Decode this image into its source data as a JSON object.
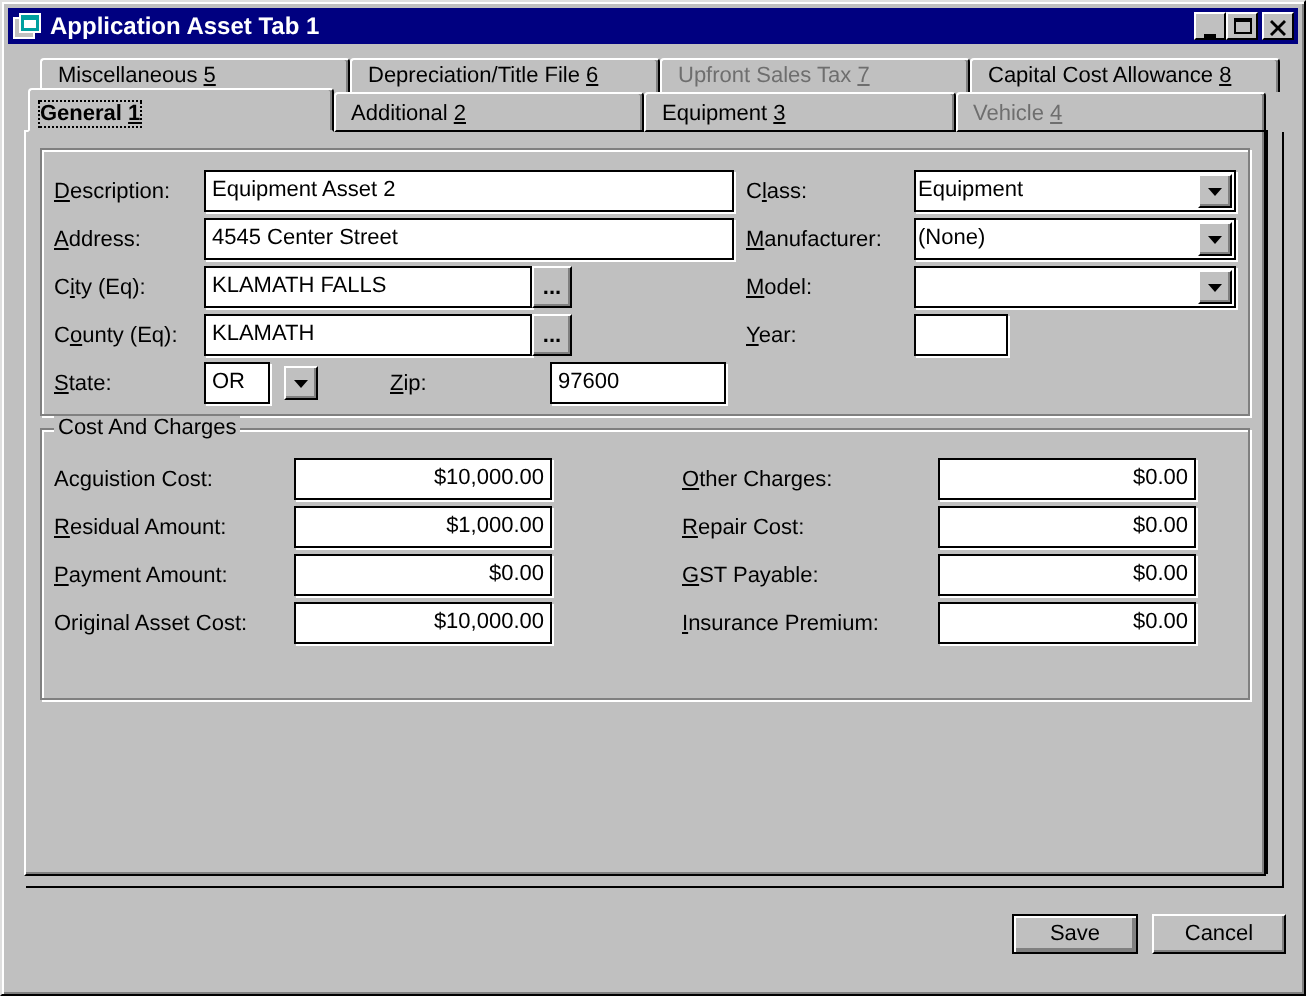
{
  "window": {
    "title": "Application Asset Tab 1"
  },
  "tab_rows": [
    [
      {
        "label": {
          "pre": "Miscellaneous ",
          "key": "5"
        },
        "selected": false,
        "disabled": false
      },
      {
        "label": {
          "pre": "Depreciation/Title File ",
          "key": "6"
        },
        "selected": false,
        "disabled": false
      },
      {
        "label": {
          "pre": "Upfront Sales Tax ",
          "key": "7"
        },
        "selected": false,
        "disabled": true
      },
      {
        "label": {
          "pre": "Capital Cost Allowance ",
          "key": "8"
        },
        "selected": false,
        "disabled": false
      }
    ],
    [
      {
        "label": {
          "pre": "General ",
          "key": "1"
        },
        "selected": true,
        "disabled": false
      },
      {
        "label": {
          "pre": "Additional ",
          "key": "2"
        },
        "selected": false,
        "disabled": false
      },
      {
        "label": {
          "pre": "Equipment ",
          "key": "3"
        },
        "selected": false,
        "disabled": false
      },
      {
        "label": {
          "pre": "Vehicle ",
          "key": "4"
        },
        "selected": false,
        "disabled": true
      }
    ]
  ],
  "general": {
    "left": [
      {
        "kind": "text",
        "label": {
          "key": "D",
          "post": "escription:"
        },
        "value": "Equipment Asset 2"
      },
      {
        "kind": "text",
        "label": {
          "key": "A",
          "post": "ddress:"
        },
        "value": "4545 Center Street"
      },
      {
        "kind": "lookup",
        "label": {
          "pre": "C",
          "key": "i",
          "post": "ty (Eq):"
        },
        "value": "KLAMATH FALLS",
        "button": "..."
      },
      {
        "kind": "lookup",
        "label": {
          "pre": "C",
          "key": "o",
          "post": "unty (Eq):"
        },
        "value": "KLAMATH",
        "button": "..."
      },
      {
        "kind": "state_zip",
        "label": {
          "key": "S",
          "post": "tate:"
        },
        "value": "OR",
        "zip_label": {
          "key": "Z",
          "post": "ip:"
        },
        "zip_value": "97600"
      }
    ],
    "right": [
      {
        "kind": "dropdown",
        "label": {
          "pre": "C",
          "key": "l",
          "post": "ass:"
        },
        "value": "Equipment"
      },
      {
        "kind": "dropdown",
        "label": {
          "key": "M",
          "post": "anufacturer:"
        },
        "value": "(None)"
      },
      {
        "kind": "dropdown",
        "label": {
          "key": "M",
          "post": "odel:"
        }
      },
      {
        "kind": "short",
        "label": {
          "key": "Y",
          "post": "ear:"
        }
      }
    ]
  },
  "costs": {
    "title": "Cost And Charges",
    "left": [
      {
        "label": {
          "pre": "Acguistion Cost:"
        },
        "value": "$10,000.00"
      },
      {
        "label": {
          "key": "R",
          "post": "esidual Amount:"
        },
        "value": "$1,000.00"
      },
      {
        "label": {
          "key": "P",
          "post": "ayment Amount:"
        },
        "value": "$0.00"
      },
      {
        "label": {
          "pre": "Original Asset Cost:"
        },
        "value": "$10,000.00"
      }
    ],
    "right": [
      {
        "label": {
          "key": "O",
          "post": "ther Charges:"
        },
        "value": "$0.00"
      },
      {
        "label": {
          "key": "R",
          "post": "epair Cost:"
        },
        "value": "$0.00"
      },
      {
        "label": {
          "key": "G",
          "post": "ST Payable:"
        },
        "value": "$0.00"
      },
      {
        "label": {
          "key": "I",
          "post": "nsurance Premium:"
        },
        "value": "$0.00"
      }
    ]
  },
  "buttons": [
    {
      "label": "Save",
      "default": true
    },
    {
      "label": "Cancel",
      "default": false
    }
  ]
}
